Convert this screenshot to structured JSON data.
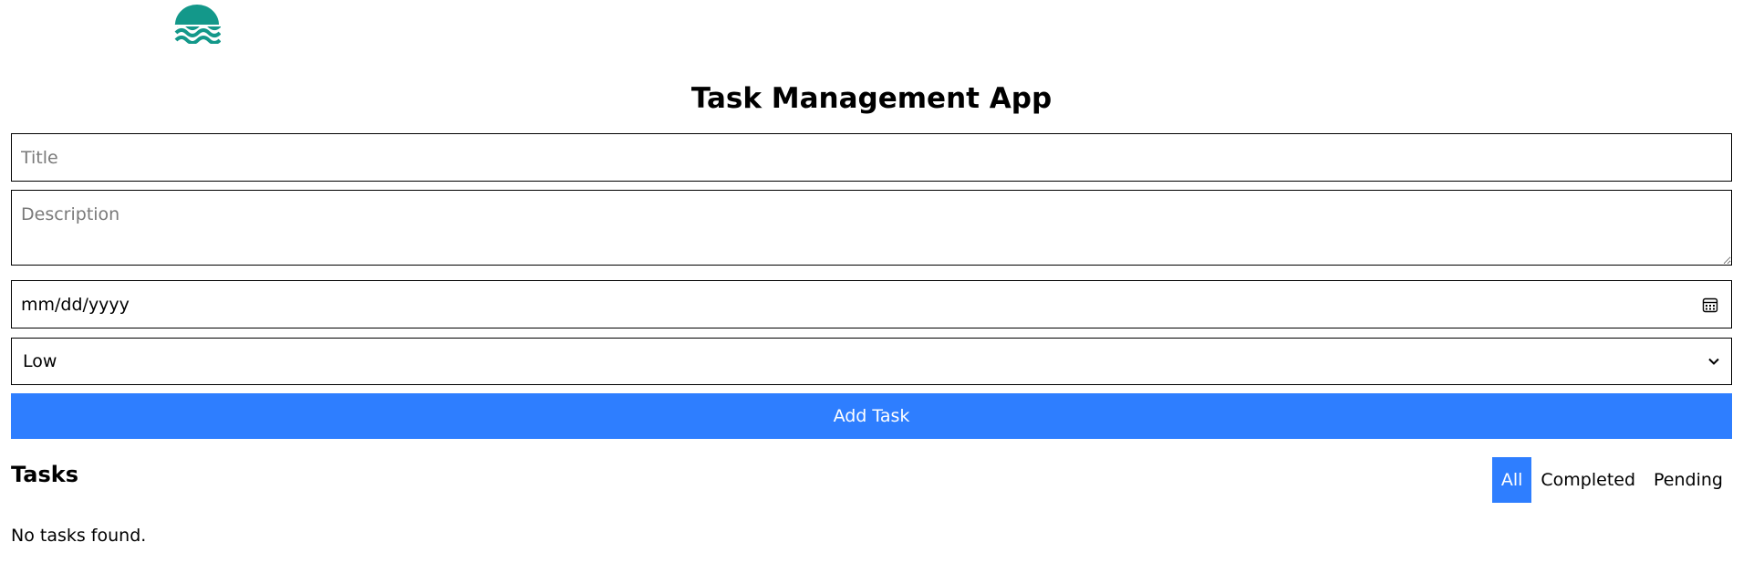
{
  "header": {
    "logo_icon": "waves-sun-logo-icon",
    "logo_color": "#13988a",
    "title": "Task Management App"
  },
  "form": {
    "title_placeholder": "Title",
    "description_placeholder": "Description",
    "date_placeholder": "mm/dd/yyyy",
    "date_icon": "calendar-icon",
    "priority_selected": "Low",
    "priority_icon": "chevron-down-icon",
    "submit_label": "Add Task"
  },
  "tasks": {
    "heading": "Tasks",
    "filters": [
      {
        "label": "All",
        "active": true
      },
      {
        "label": "Completed",
        "active": false
      },
      {
        "label": "Pending",
        "active": false
      }
    ],
    "empty_message": "No tasks found."
  },
  "colors": {
    "accent": "#2e7eff",
    "logo": "#13988a"
  }
}
